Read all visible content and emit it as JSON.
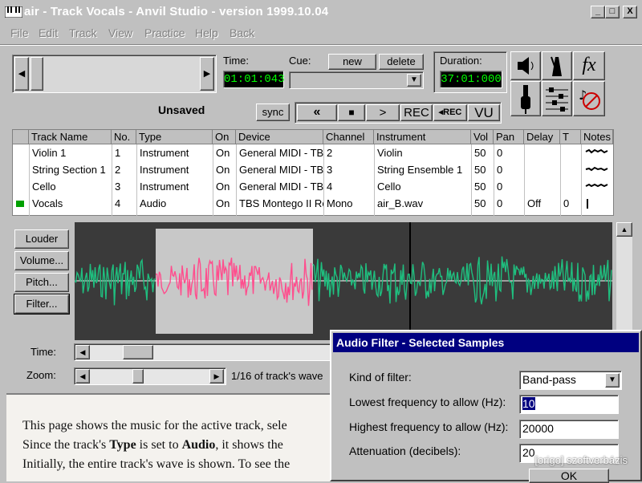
{
  "window": {
    "title": "air - Track Vocals - Anvil Studio - version 1999.10.04",
    "min": "_",
    "max": "□",
    "close": "X"
  },
  "menu": [
    "File",
    "Edit",
    "Track",
    "View",
    "Practice",
    "Help",
    "Back"
  ],
  "transport": {
    "time_label": "Time:",
    "time_value": "01:01:043",
    "cue_label": "Cue:",
    "new_label": "new",
    "delete_label": "delete",
    "duration_label": "Duration:",
    "duration_value": "37:01:000",
    "status": "Unsaved",
    "sync_label": "sync",
    "rewind": "«",
    "stop": "■",
    "play": ">",
    "rec": "REC",
    "step_rec": "◂REC",
    "vu": "VU"
  },
  "tools": {
    "fx": "fx"
  },
  "table": {
    "headers": [
      "Track Name",
      "No.",
      "Type",
      "On",
      "Device",
      "Channel",
      "Instrument",
      "Vol",
      "Pan",
      "Delay",
      "T",
      "Notes"
    ],
    "rows": [
      [
        "Violin 1",
        "1",
        "Instrument",
        "On",
        "General MIDI - TBS",
        "2",
        "Violin",
        "50",
        "0",
        "",
        "",
        ""
      ],
      [
        "String Section 1",
        "2",
        "Instrument",
        "On",
        "General MIDI - TBS",
        "3",
        "String Ensemble 1",
        "50",
        "0",
        "",
        "",
        ""
      ],
      [
        "Cello",
        "3",
        "Instrument",
        "On",
        "General MIDI - TBS",
        "4",
        "Cello",
        "50",
        "0",
        "",
        "",
        ""
      ],
      [
        "Vocals",
        "4",
        "Audio",
        "On",
        "TBS Montego II Re",
        "Mono",
        "air_B.wav",
        "50",
        "0",
        "Off",
        "0",
        ""
      ]
    ]
  },
  "side_buttons": [
    "Louder",
    "Volume...",
    "Pitch...",
    "Filter..."
  ],
  "time_label": "Time:",
  "zoom_label": "Zoom:",
  "zoom_text": "1/16 of track's wave",
  "doc": {
    "line1": "This page shows the music for the active track, sele",
    "line2a": "Since the track's ",
    "line2b": "Type",
    "line2c": " is set to ",
    "line2d": "Audio",
    "line2e": ", it shows the",
    "line3": "Initially, the entire track's wave is shown. To see the"
  },
  "dialog": {
    "title": "Audio Filter - Selected Samples",
    "kind_label": "Kind of filter:",
    "kind_value": "Band-pass",
    "low_label": "Lowest frequency to allow (Hz):",
    "low_value": "10",
    "high_label": "Highest frequency to allow (Hz):",
    "high_value": "20000",
    "atten_label": "Attenuation (decibels):",
    "atten_value": "20",
    "ok_label": "OK"
  },
  "watermark": "[origo] szoftverbázis",
  "colors": {
    "lcd": "#00ff00",
    "wave_selected": "#ff4d8d",
    "wave": "#1fbf7f",
    "titlebar": "#000080"
  }
}
